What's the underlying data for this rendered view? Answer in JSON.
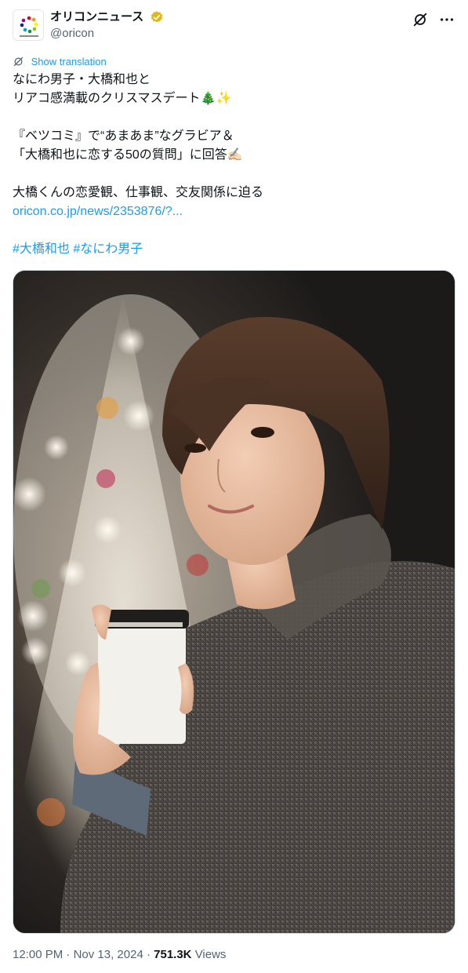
{
  "author": {
    "display_name": "オリコンニュース",
    "handle": "@oricon",
    "verified_badge": "gold-verified-icon",
    "brand_color": "#d4a017"
  },
  "actions": {
    "grok_icon": "grok-icon",
    "more_icon": "more-icon"
  },
  "translate": {
    "label": "Show translation",
    "icon": "translate-icon"
  },
  "tweet": {
    "line1": "なにわ男子・大橋和也と",
    "line2": "リアコ感満載のクリスマスデート🎄✨",
    "line3": "『ベツコミ』で“あまあま”なグラビア＆",
    "line4": "「大橋和也に恋する50の質問」に回答✍🏻",
    "line5": "大橋くんの恋愛観、仕事観、交友関係に迫る",
    "link": "oricon.co.jp/news/2353876/?...",
    "hashtag1": "#大橋和也",
    "hashtag2": "#なにわ男子"
  },
  "meta": {
    "time": "12:00 PM",
    "separator1": "·",
    "date": "Nov 13, 2024",
    "separator2": "·",
    "views_count": "751.3K",
    "views_label": "Views"
  },
  "colors": {
    "link": "#1d9bf0",
    "secondary_text": "#536471",
    "primary_text": "#0f1419"
  }
}
